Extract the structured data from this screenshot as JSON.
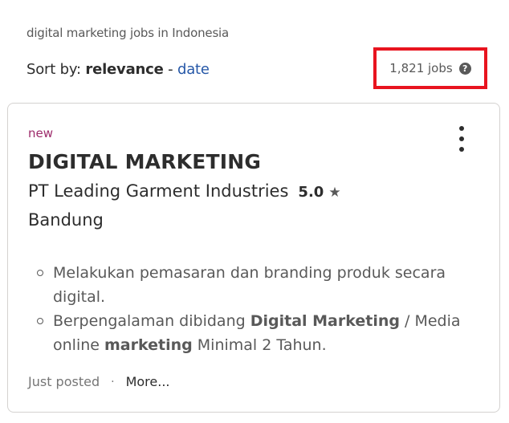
{
  "breadcrumb": "digital marketing jobs in Indonesia",
  "sort": {
    "label": "Sort by:",
    "active": "relevance",
    "separator": "-",
    "alternate": "date"
  },
  "job_count": {
    "text": "1,821 jobs",
    "help_icon": "question-circle-icon",
    "highlight_color": "#e8141f"
  },
  "job_card": {
    "badge": "new",
    "title": "DIGITAL MARKETING",
    "company": "PT Leading Garment Industries",
    "rating": "5.0",
    "rating_icon": "star-icon",
    "location": "Bandung",
    "snippet": [
      {
        "parts": [
          "Melakukan pemasaran dan branding produk secara digital."
        ]
      },
      {
        "parts": [
          "Berpengalaman dibidang ",
          "Digital Marketing",
          " / Media online ",
          "marketing",
          " Minimal 2 Tahun."
        ]
      }
    ],
    "posted": "Just posted",
    "more_link": "More..."
  },
  "colors": {
    "link": "#2557a7",
    "badge": "#9d2b6b",
    "text": "#2d2d2d",
    "muted": "#595959"
  }
}
